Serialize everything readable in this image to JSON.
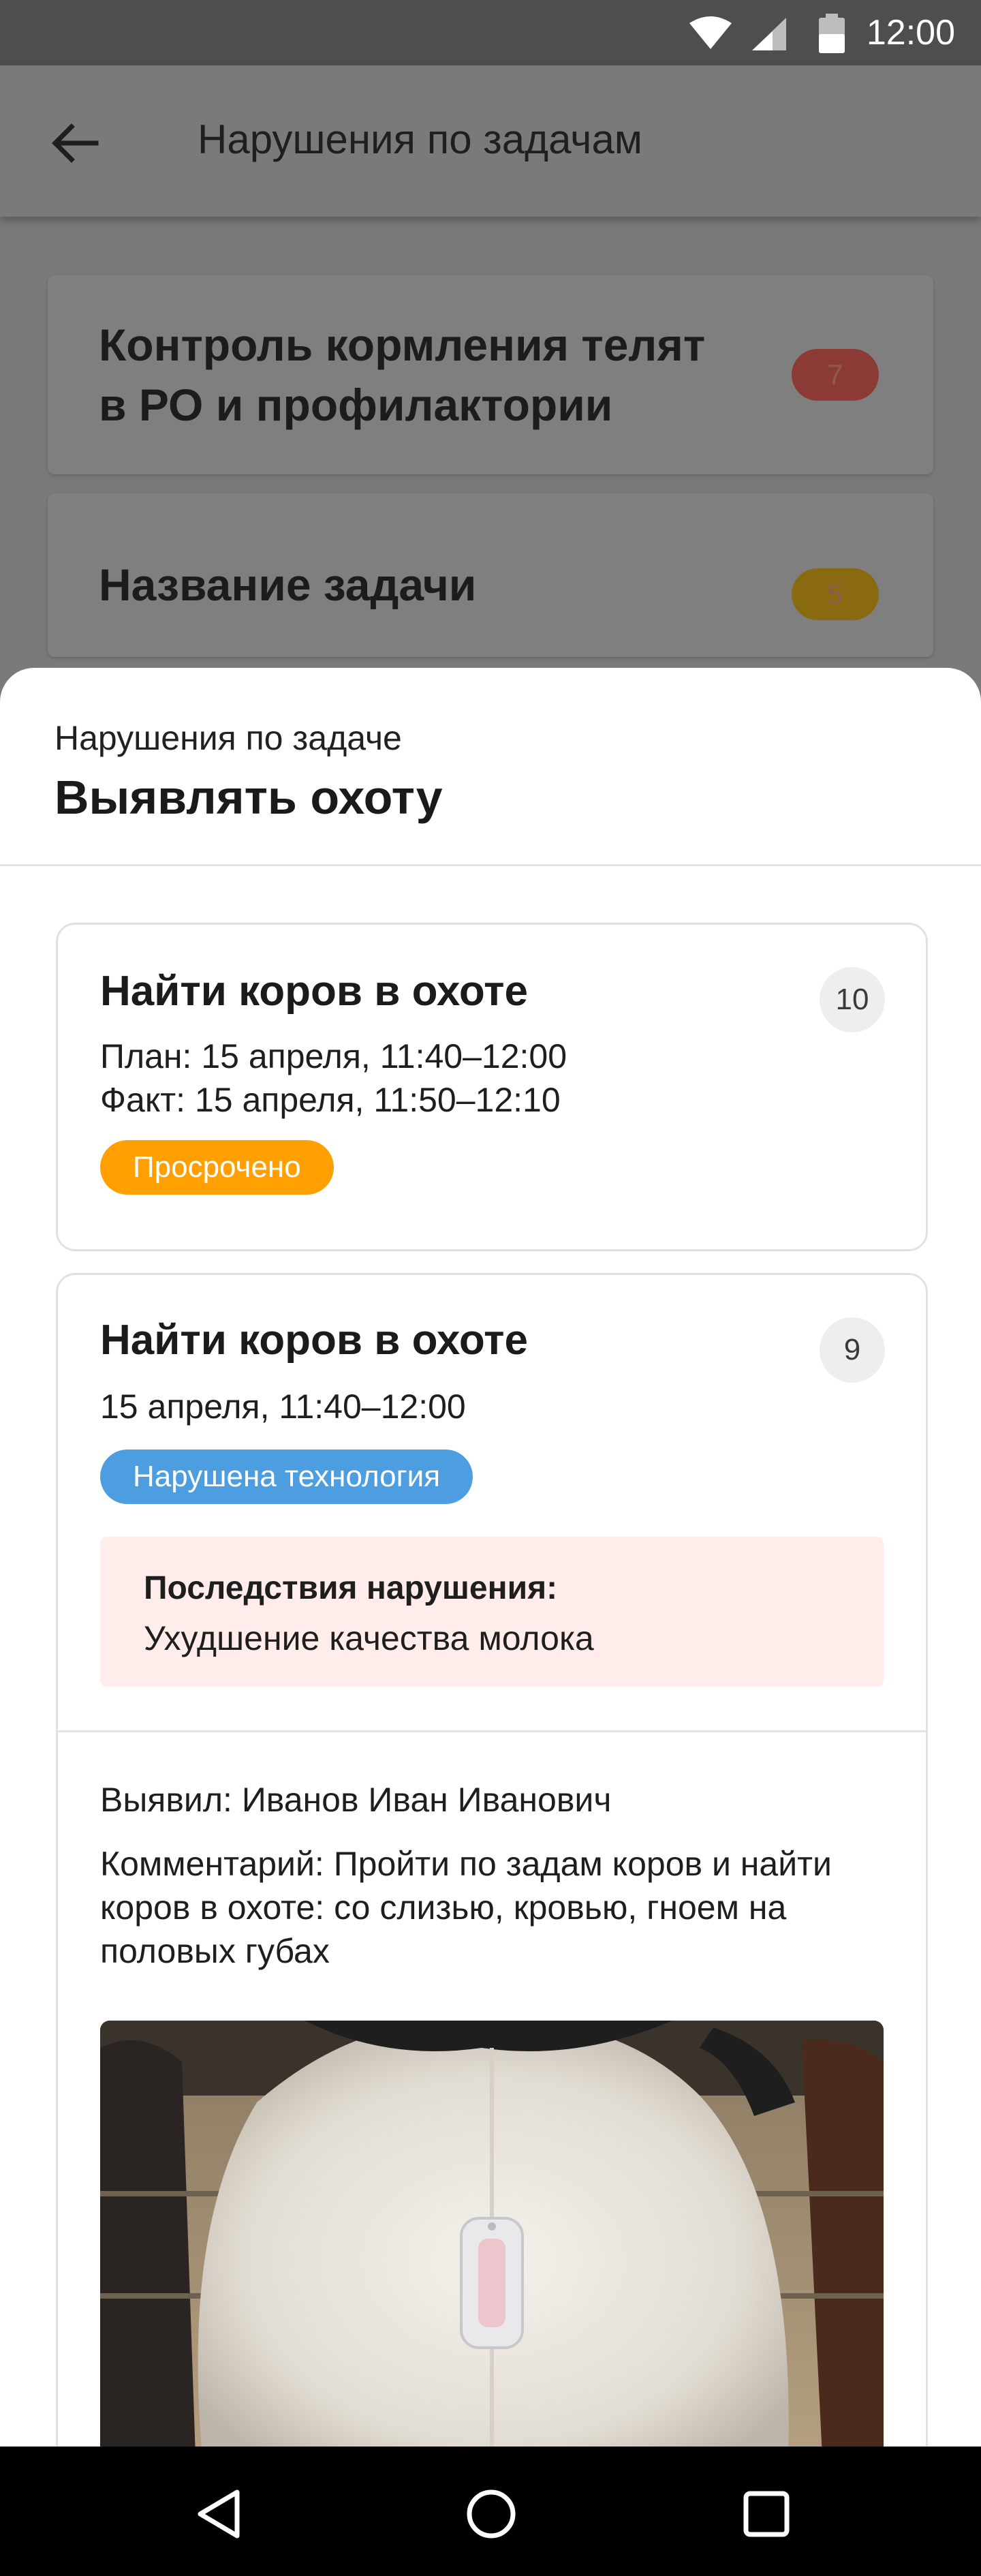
{
  "status_bar": {
    "time": "12:00",
    "icons": [
      "wifi-icon",
      "signal-icon",
      "battery-icon"
    ]
  },
  "app_bar": {
    "title": "Нарушения по задачам",
    "back_icon": "arrow-back-icon"
  },
  "background_tasks": [
    {
      "title_line1": "Контроль кормления телят",
      "title_line2": "в РО и профилактории",
      "count": "7",
      "badge_color": "#8b3a36"
    },
    {
      "title": "Название задачи",
      "count": "5",
      "badge_color": "#8a6a10"
    }
  ],
  "sheet": {
    "subtitle": "Нарушения по задаче",
    "title": "Выявлять охоту",
    "violations": [
      {
        "title": "Найти коров в охоте",
        "count": "10",
        "plan": "План: 15 апреля, 11:40–12:00",
        "fact": "Факт: 15 апреля, 11:50–12:10",
        "status": "Просрочено",
        "status_color": "#FFA000"
      },
      {
        "title": "Найти коров в охоте",
        "count": "9",
        "time": "15 апреля, 11:40–12:00",
        "status": "Нарушена технология",
        "status_color": "#4C9EE0",
        "consequence_title": "Последствия нарушения:",
        "consequence_text": "Ухудшение качества молока",
        "detected_by": "Выявил: Иванов Иван Иванович",
        "comment": "Комментарий: Пройти по задам коров и найти коров в охоте: со слизью, кровью, гноем на половых губах"
      }
    ]
  },
  "nav_bar": {
    "icons": [
      "nav-back-icon",
      "nav-home-icon",
      "nav-recents-icon"
    ]
  }
}
